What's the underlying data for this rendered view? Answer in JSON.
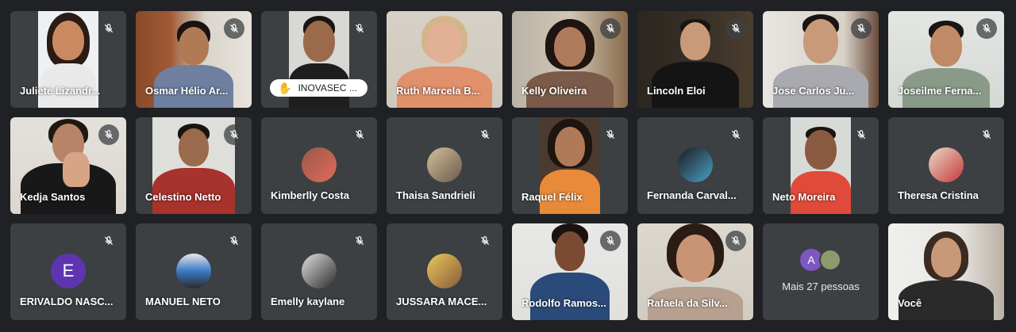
{
  "participants": [
    {
      "name": "Juliete Lizandr...",
      "muted": true
    },
    {
      "name": "Osmar Hélio Ar...",
      "muted": true
    },
    {
      "name": "INOVASEC ...",
      "muted": true,
      "hand_raised": true
    },
    {
      "name": "Ruth Marcela B...",
      "muted": true
    },
    {
      "name": "Kelly Oliveira",
      "muted": true
    },
    {
      "name": "Lincoln Eloi",
      "muted": true
    },
    {
      "name": "Jose Carlos Ju...",
      "muted": true
    },
    {
      "name": "Joseilme Ferna...",
      "muted": true
    },
    {
      "name": "Kedja Santos",
      "muted": true
    },
    {
      "name": "Celestino Netto",
      "muted": true
    },
    {
      "name": "Kimberlly Costa",
      "muted": true
    },
    {
      "name": "Thaisa Sandrieli",
      "muted": true
    },
    {
      "name": "Raquel Félix",
      "muted": true
    },
    {
      "name": "Fernanda Carval...",
      "muted": true
    },
    {
      "name": "Neto Moreira",
      "muted": true
    },
    {
      "name": "Theresa Cristina",
      "muted": true
    },
    {
      "name": "ERIVALDO NASC...",
      "muted": true,
      "avatar_letter": "E"
    },
    {
      "name": "MANUEL NETO",
      "muted": true
    },
    {
      "name": "Emelly kaylane",
      "muted": true
    },
    {
      "name": "JUSSARA MACE...",
      "muted": true
    },
    {
      "name": "Rodolfo Ramos...",
      "muted": true
    },
    {
      "name": "Rafaela da Silv...",
      "muted": true
    },
    {
      "name": "Você",
      "muted": false
    }
  ],
  "more": {
    "label": "Mais 27 pessoas",
    "avatar_letter": "A"
  },
  "icons": {
    "mic_off": "mic-off-icon",
    "hand": "raised-hand-icon"
  },
  "colors": {
    "background": "#202124",
    "tile": "#3c4043",
    "letter_avatar": "#5e35b1"
  }
}
